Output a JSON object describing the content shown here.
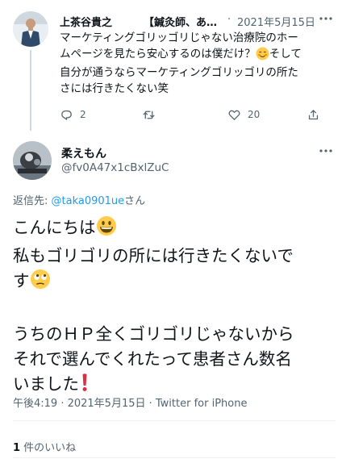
{
  "parent_tweet": {
    "author_name": "上茶谷貴之",
    "author_title": "【鍼灸師、あ…",
    "separator": "·",
    "date": "2021年5月15日",
    "text": "マーケティングゴリッゴリじゃない治療院のホームページを見たら安心するのは僕だけ？☺️そして自分が通うならマーケティングゴリッゴリの所たさには行きたくない笑",
    "text_lines": [
      "マーケティングゴリッゴリじゃない治療院のホー",
      "ムページを見たら安心するのは僕だけ？",
      "自分が通うならマーケティングゴリッゴリの所た",
      "さには行きたくない笑"
    ],
    "line2_tail": "そして",
    "reply_count": "2",
    "retweet_count": "",
    "like_count": "20"
  },
  "main_tweet": {
    "author_name": "柔えもん",
    "handle": "@fv0A47x1cBxlZuC",
    "reply_label": "返信先: ",
    "reply_to": "@taka0901ue",
    "reply_suffix": "さん",
    "lines": {
      "l1": "こんにちは",
      "l2": "私もゴリゴリの所には行きたくないで",
      "l3": "す",
      "l4": "うちのＨＰ全くゴリゴリじゃないから",
      "l5": "それで選んでくれたって患者さん数名",
      "l6": "いました"
    },
    "timestamp": "午後4:19 · 2021年5月15日 · Twitter for iPhone",
    "like_count": "1",
    "like_label": " 件のいいね"
  },
  "icons": [
    "more-icon",
    "reply-icon",
    "retweet-icon",
    "like-icon",
    "share-icon"
  ],
  "colors": {
    "secondary_text": "#536471",
    "link": "#1d9bf0",
    "line": "#cfd9de"
  }
}
